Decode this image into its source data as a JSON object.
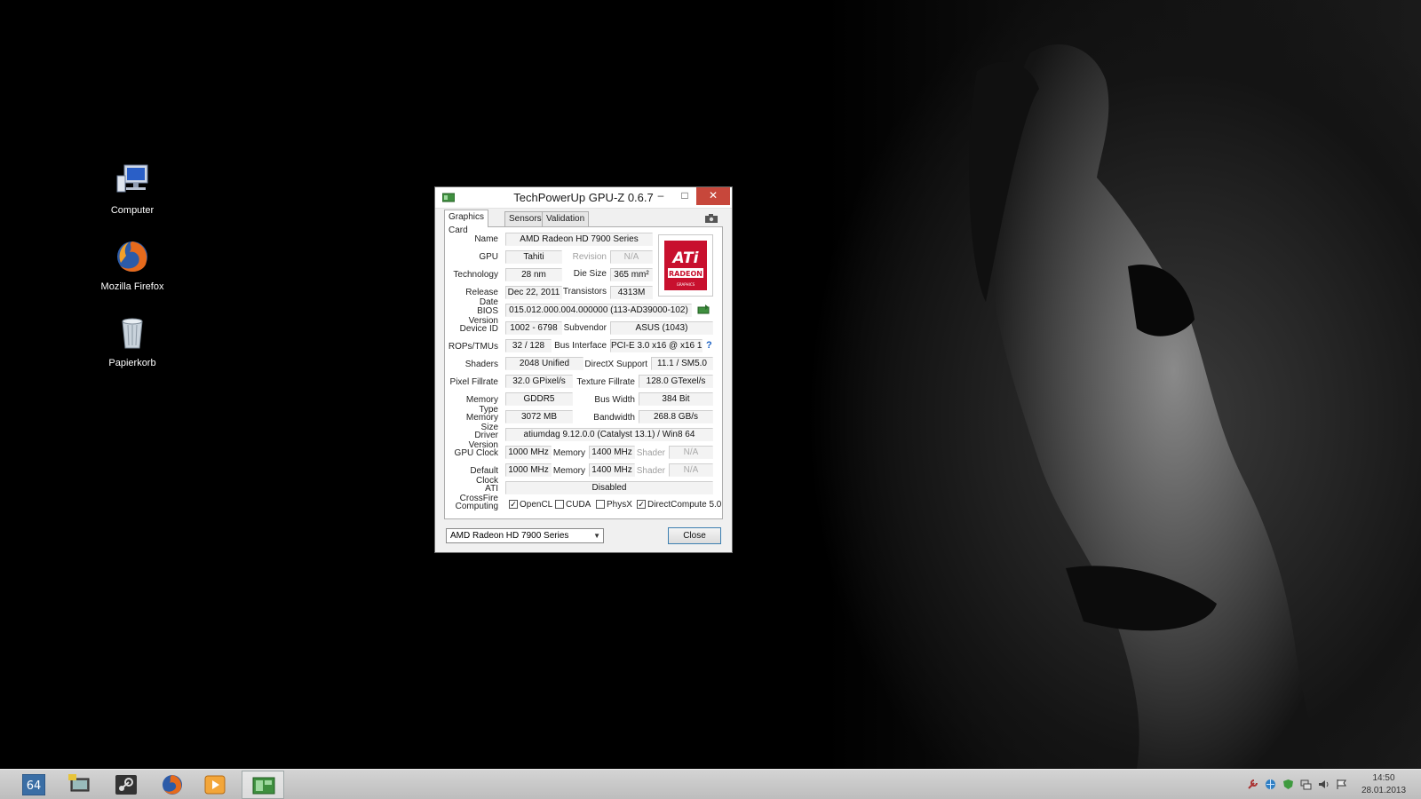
{
  "desktop": {
    "icons": [
      {
        "label": "Computer"
      },
      {
        "label": "Mozilla Firefox"
      },
      {
        "label": "Papierkorb"
      }
    ]
  },
  "window": {
    "title": "TechPowerUp GPU-Z 0.6.7",
    "tabs": [
      {
        "label": "Graphics Card",
        "active": true
      },
      {
        "label": "Sensors",
        "active": false
      },
      {
        "label": "Validation",
        "active": false
      }
    ],
    "fields": {
      "name_label": "Name",
      "name": "AMD Radeon HD 7900 Series",
      "gpu_label": "GPU",
      "gpu": "Tahiti",
      "revision_label": "Revision",
      "revision": "N/A",
      "technology_label": "Technology",
      "technology": "28 nm",
      "die_size_label": "Die Size",
      "die_size": "365 mm²",
      "release_date_label": "Release Date",
      "release_date": "Dec 22, 2011",
      "transistors_label": "Transistors",
      "transistors": "4313M",
      "bios_label": "BIOS Version",
      "bios": "015.012.000.004.000000 (113-AD39000-102)",
      "device_id_label": "Device ID",
      "device_id": "1002 - 6798",
      "subvendor_label": "Subvendor",
      "subvendor": "ASUS (1043)",
      "rops_label": "ROPs/TMUs",
      "rops": "32 / 128",
      "bus_interface_label": "Bus Interface",
      "bus_interface": "PCI-E 3.0 x16 @ x16 1.1",
      "shaders_label": "Shaders",
      "shaders": "2048 Unified",
      "directx_label": "DirectX Support",
      "directx": "11.1 / SM5.0",
      "pixel_fillrate_label": "Pixel Fillrate",
      "pixel_fillrate": "32.0 GPixel/s",
      "texture_fillrate_label": "Texture Fillrate",
      "texture_fillrate": "128.0 GTexel/s",
      "memory_type_label": "Memory Type",
      "memory_type": "GDDR5",
      "bus_width_label": "Bus Width",
      "bus_width": "384 Bit",
      "memory_size_label": "Memory Size",
      "memory_size": "3072 MB",
      "bandwidth_label": "Bandwidth",
      "bandwidth": "268.8 GB/s",
      "driver_label": "Driver Version",
      "driver": "atiumdag 9.12.0.0 (Catalyst 13.1) / Win8 64",
      "gpu_clock_label": "GPU Clock",
      "gpu_clock": "1000 MHz",
      "gpu_clock_memory_label": "Memory",
      "gpu_clock_memory": "1400 MHz",
      "gpu_clock_shader_label": "Shader",
      "gpu_clock_shader": "N/A",
      "default_clock_label": "Default Clock",
      "default_clock": "1000 MHz",
      "default_clock_memory_label": "Memory",
      "default_clock_memory": "1400 MHz",
      "default_clock_shader_label": "Shader",
      "default_clock_shader": "N/A",
      "crossfire_label": "ATI CrossFire",
      "crossfire": "Disabled",
      "computing_label": "Computing"
    },
    "computing": [
      {
        "label": "OpenCL",
        "checked": true
      },
      {
        "label": "CUDA",
        "checked": false
      },
      {
        "label": "PhysX",
        "checked": false
      },
      {
        "label": "DirectCompute 5.0",
        "checked": true
      }
    ],
    "logo_text": {
      "brand": "ATi",
      "line": "RADEON",
      "sub": "GRAPHICS"
    },
    "gpu_select": "AMD Radeon HD 7900 Series",
    "close_label": "Close",
    "question_mark": "?"
  },
  "taskbar": {
    "start_label": "64",
    "clock_time": "14:50",
    "clock_date": "28.01.2013"
  },
  "colors": {
    "close_red": "#c7473b",
    "ati_red": "#c8102e",
    "taskbar": "#c8c8c8"
  }
}
